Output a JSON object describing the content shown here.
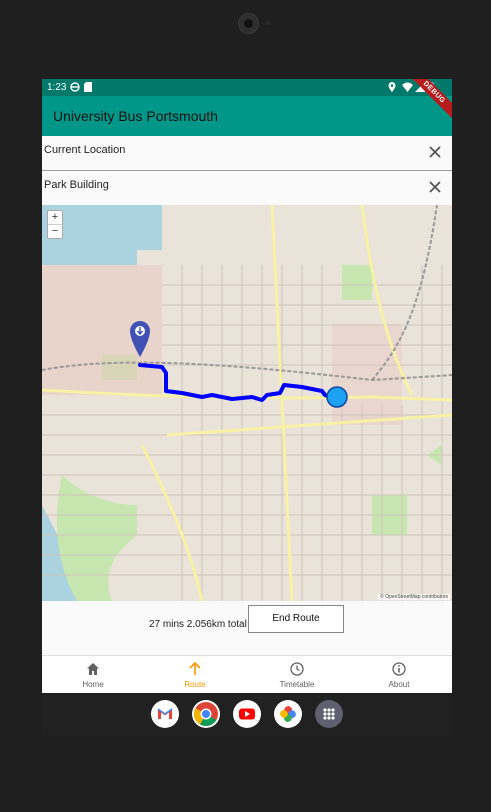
{
  "status_bar": {
    "time": "1:23"
  },
  "app_bar": {
    "title": "University Bus Portsmouth",
    "debug_banner": "DEBUG"
  },
  "origin_field": {
    "value": "Current Location"
  },
  "destination_field": {
    "value": "Park Building"
  },
  "map": {
    "zoom_in": "+",
    "zoom_out": "−",
    "attribution": "© OpenStreetMap contributors"
  },
  "route": {
    "summary": "27 mins 2.056km total",
    "end_button": "End Route"
  },
  "bottom_nav": {
    "items": [
      {
        "label": "Home",
        "icon": "home-icon"
      },
      {
        "label": "Route",
        "icon": "arrow-up-icon"
      },
      {
        "label": "Timetable",
        "icon": "clock-icon"
      },
      {
        "label": "About",
        "icon": "info-icon"
      }
    ],
    "active": "Route"
  },
  "dock": [
    "gmail-icon",
    "chrome-icon",
    "youtube-icon",
    "photos-icon",
    "app-drawer-icon"
  ],
  "colors": {
    "app_bar": "#009688",
    "status_bar": "#00796b",
    "route_line": "#0000ff",
    "location_dot": "#1da1f2",
    "active_tab": "#ff9800"
  }
}
